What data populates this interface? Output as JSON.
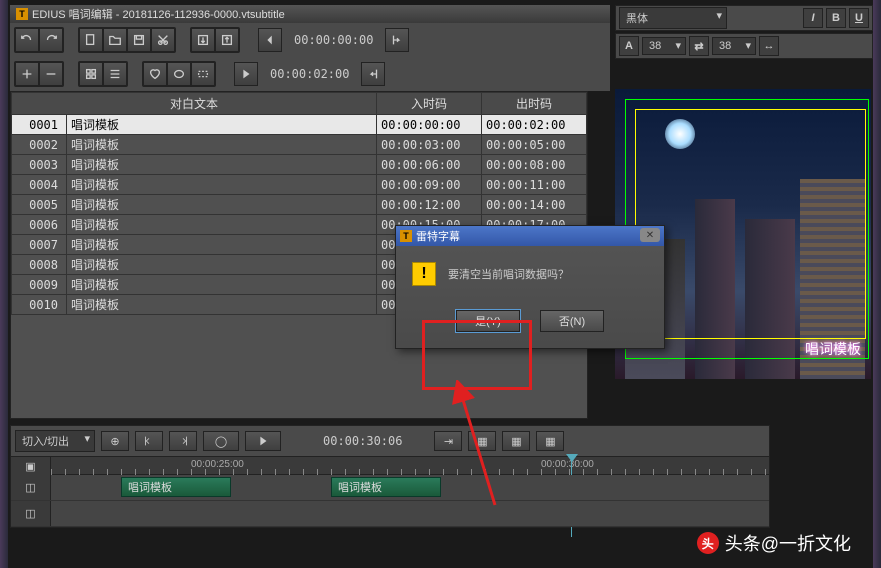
{
  "app": {
    "title": "EDIUS 唱词编辑 - 20181126-112936-0000.vtsubtitle"
  },
  "timestamps": {
    "t1": "00:00:00:00",
    "t2": "00:00:02:00"
  },
  "table": {
    "headers": [
      "对白文本",
      "入时码",
      "出时码"
    ],
    "rows": [
      {
        "id": "0001",
        "text": "唱词模板",
        "in": "00:00:00:00",
        "out": "00:00:02:00"
      },
      {
        "id": "0002",
        "text": "唱词模板",
        "in": "00:00:03:00",
        "out": "00:00:05:00"
      },
      {
        "id": "0003",
        "text": "唱词模板",
        "in": "00:00:06:00",
        "out": "00:00:08:00"
      },
      {
        "id": "0004",
        "text": "唱词模板",
        "in": "00:00:09:00",
        "out": "00:00:11:00"
      },
      {
        "id": "0005",
        "text": "唱词模板",
        "in": "00:00:12:00",
        "out": "00:00:14:00"
      },
      {
        "id": "0006",
        "text": "唱词模板",
        "in": "00:00:15:00",
        "out": "00:00:17:00"
      },
      {
        "id": "0007",
        "text": "唱词模板",
        "in": "00",
        "out": ""
      },
      {
        "id": "0008",
        "text": "唱词模板",
        "in": "00",
        "out": ""
      },
      {
        "id": "0009",
        "text": "唱词模板",
        "in": "00",
        "out": ""
      },
      {
        "id": "0010",
        "text": "唱词模板",
        "in": "00",
        "out": ""
      }
    ]
  },
  "font": {
    "family": "黑体",
    "size1": "38",
    "size2": "38"
  },
  "dialog": {
    "title": "雷特字幕",
    "message": "要清空当前唱词数据吗？",
    "yes": "是(Y)",
    "no": "否(N)"
  },
  "preview": {
    "caption": "唱词模板"
  },
  "timeline": {
    "mode": "切入/切出",
    "position": "00:00:30:06",
    "marks": [
      "00:00:25:00",
      "00:00:30:00"
    ],
    "clips": [
      "唱词模板",
      "唱词模板"
    ]
  },
  "watermark": "头条@一折文化"
}
